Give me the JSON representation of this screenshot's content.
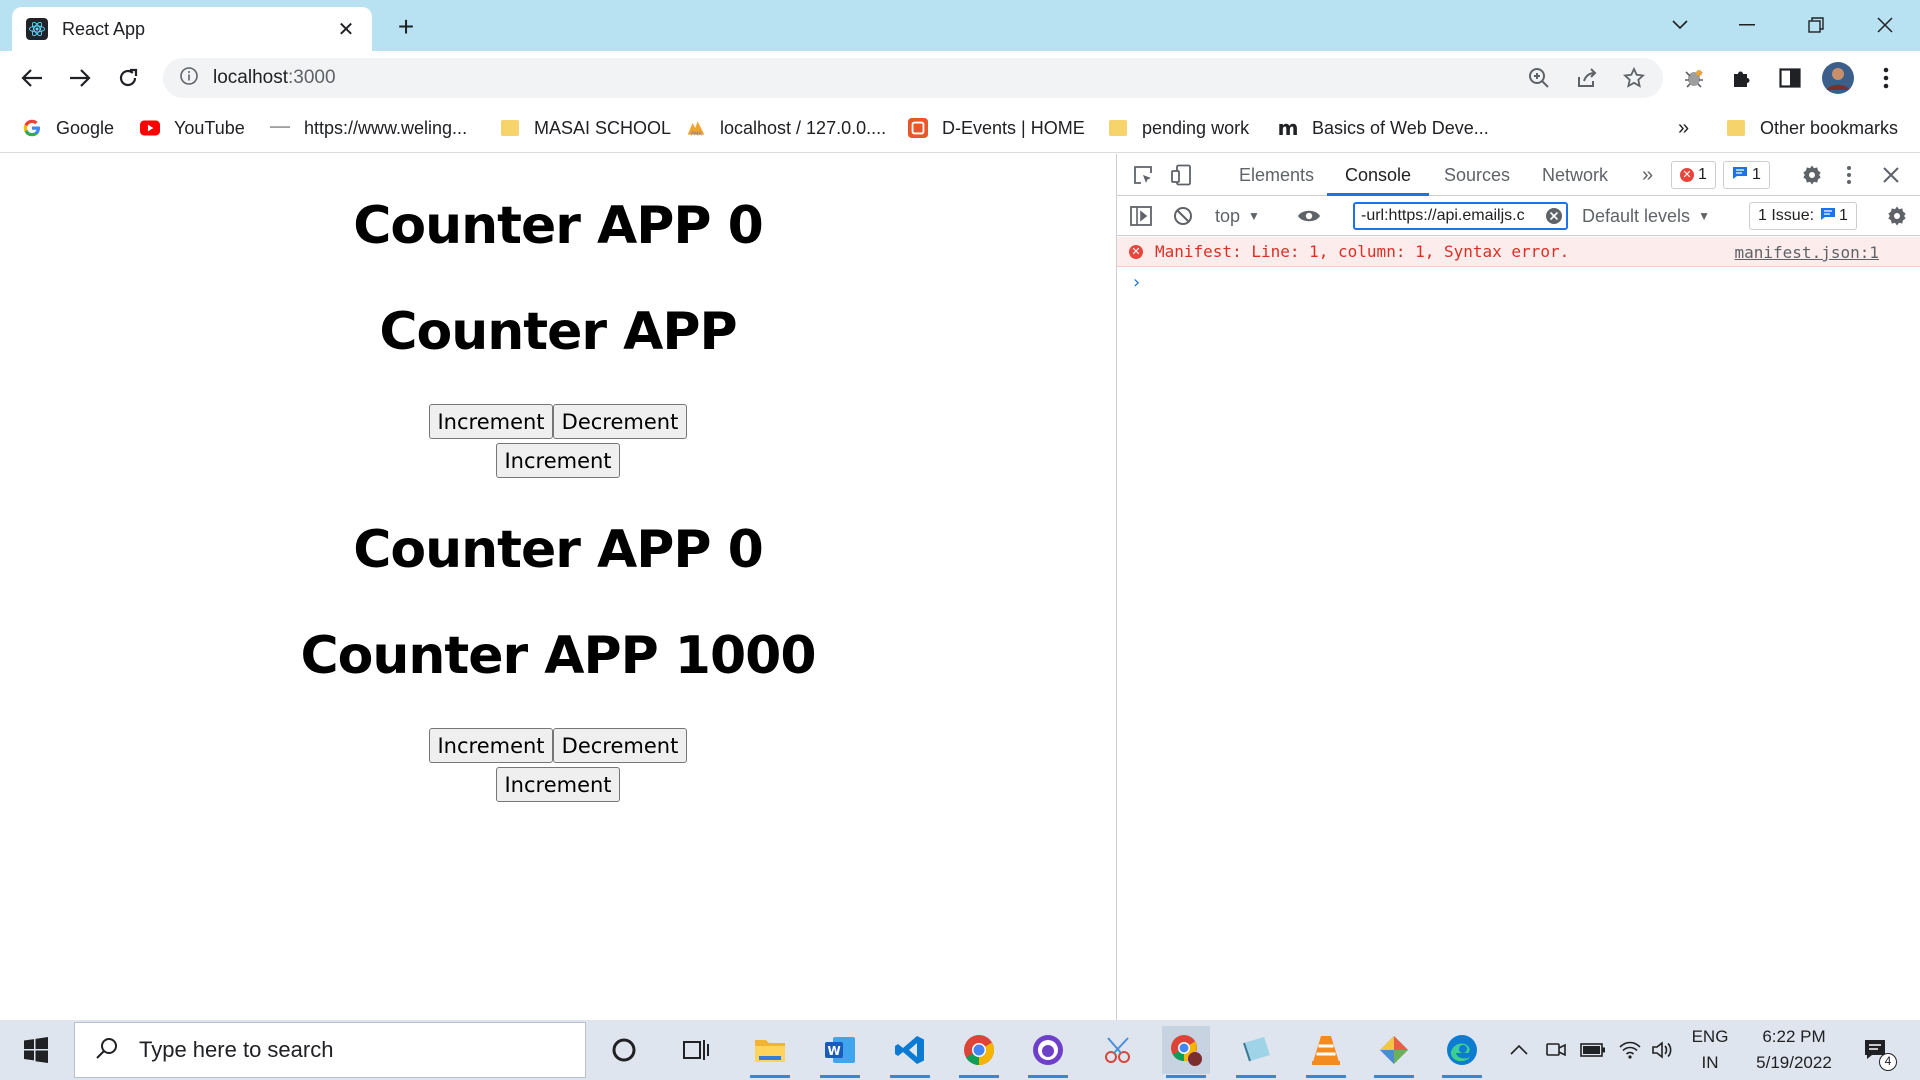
{
  "browser": {
    "tab_title": "React App",
    "tab_close_glyph": "✕",
    "new_tab_glyph": "+",
    "url_host": "localhost",
    "url_port": ":3000",
    "window_controls": {
      "minimize": "—",
      "restore": "❐",
      "close": "✕",
      "tab_search": "⌄"
    }
  },
  "bookmarks": [
    {
      "label": "Google",
      "icon": "google-icon"
    },
    {
      "label": "YouTube",
      "icon": "youtube-icon"
    },
    {
      "label": "https://www.weling...",
      "icon": "site-icon"
    },
    {
      "label": "MASAI SCHOOL",
      "icon": "folder-icon"
    },
    {
      "label": "localhost / 127.0.0....",
      "icon": "phpmyadmin-icon"
    },
    {
      "label": "D-Events | HOME",
      "icon": "devents-icon"
    },
    {
      "label": "pending work",
      "icon": "folder-icon"
    },
    {
      "label": "Basics of Web Deve...",
      "icon": "m-icon"
    }
  ],
  "bookmarks_overflow": "»",
  "other_bookmarks": "Other bookmarks",
  "page": {
    "heading_1": "Counter APP 0",
    "heading_2": "Counter APP",
    "heading_3": "Counter APP 0",
    "heading_4": "Counter APP 1000",
    "increment_label": "Increment",
    "decrement_label": "Decrement"
  },
  "devtools": {
    "tabs": [
      "Elements",
      "Console",
      "Sources",
      "Network"
    ],
    "active_tab": "Console",
    "more_tabs": "»",
    "error_count": "1",
    "message_count": "1",
    "context": "top",
    "filter_value": "-url:https://api.emailjs.c",
    "levels": "Default levels",
    "issues_label": "1 Issue:",
    "issues_count": "1",
    "error_message": "Manifest: Line: 1, column: 1, Syntax error.",
    "error_source": "manifest.json:1",
    "prompt": "›"
  },
  "taskbar": {
    "search_placeholder": "Type here to search",
    "lang_top": "ENG",
    "lang_bottom": "IN",
    "time": "6:22 PM",
    "date": "5/19/2022",
    "notification_count": "4",
    "tray_caret": "^"
  },
  "colors": {
    "tabstrip_bg": "#b8e2f1",
    "taskbar_bg": "#dee5ee",
    "devtools_accent": "#1a73e8",
    "error_red": "#d93025"
  }
}
